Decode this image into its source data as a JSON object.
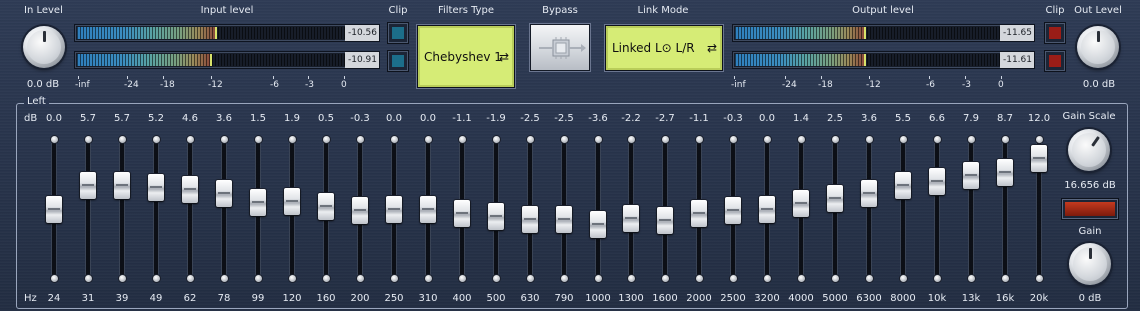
{
  "colors": {
    "lcd_bg": "#d6ec76",
    "clip_idle": "#1c6e8a",
    "clip_lit": "#9a1d17",
    "gain_scale_button": "#c43a1f"
  },
  "input": {
    "level_label": "In Level",
    "level_value": "0.0 dB",
    "meter_label": "Input level",
    "clip_label": "Clip",
    "channels": [
      {
        "value": "-10.56",
        "level": 0.52,
        "peak": 0.52
      },
      {
        "value": "-10.91",
        "level": 0.5,
        "peak": 0.5
      }
    ],
    "clip_leds": [
      "off",
      "off"
    ]
  },
  "meter_scale": [
    "-inf",
    "-24",
    "-18",
    "-12",
    "-6",
    "-3",
    "0"
  ],
  "filters": {
    "label": "Filters Type",
    "value": "Chebyshev 1",
    "icon": "swap-arrows-icon"
  },
  "bypass": {
    "label": "Bypass",
    "icon": "bypass-chip-icon"
  },
  "link": {
    "label": "Link Mode",
    "value": "Linked L⊙ L/R",
    "icon": "swap-arrows-icon"
  },
  "output": {
    "meter_label": "Output level",
    "clip_label": "Clip",
    "level_label": "Out Level",
    "level_value": "0.0 dB",
    "channels": [
      {
        "value": "-11.65",
        "level": 0.49,
        "peak": 0.49
      },
      {
        "value": "-11.61",
        "level": 0.49,
        "peak": 0.49
      }
    ],
    "clip_leds": [
      "on",
      "on"
    ]
  },
  "eq": {
    "group_label": "Left",
    "db_label": "dB",
    "hz_label": "Hz",
    "range_db": [
      -12,
      12
    ],
    "bands": [
      {
        "freq": "24",
        "gain": "0.0"
      },
      {
        "freq": "31",
        "gain": "5.7"
      },
      {
        "freq": "39",
        "gain": "5.7"
      },
      {
        "freq": "49",
        "gain": "5.2"
      },
      {
        "freq": "62",
        "gain": "4.6"
      },
      {
        "freq": "78",
        "gain": "3.6"
      },
      {
        "freq": "99",
        "gain": "1.5"
      },
      {
        "freq": "120",
        "gain": "1.9"
      },
      {
        "freq": "160",
        "gain": "0.5"
      },
      {
        "freq": "200",
        "gain": "-0.3"
      },
      {
        "freq": "250",
        "gain": "0.0"
      },
      {
        "freq": "310",
        "gain": "0.0"
      },
      {
        "freq": "400",
        "gain": "-1.1"
      },
      {
        "freq": "500",
        "gain": "-1.9"
      },
      {
        "freq": "630",
        "gain": "-2.5"
      },
      {
        "freq": "790",
        "gain": "-2.5"
      },
      {
        "freq": "1000",
        "gain": "-3.6"
      },
      {
        "freq": "1300",
        "gain": "-2.2"
      },
      {
        "freq": "1600",
        "gain": "-2.7"
      },
      {
        "freq": "2000",
        "gain": "-1.1"
      },
      {
        "freq": "2500",
        "gain": "-0.3"
      },
      {
        "freq": "3200",
        "gain": "0.0"
      },
      {
        "freq": "4000",
        "gain": "1.4"
      },
      {
        "freq": "5000",
        "gain": "2.5"
      },
      {
        "freq": "6300",
        "gain": "3.6"
      },
      {
        "freq": "8000",
        "gain": "5.5"
      },
      {
        "freq": "10k",
        "gain": "6.6"
      },
      {
        "freq": "13k",
        "gain": "7.9"
      },
      {
        "freq": "16k",
        "gain": "8.7"
      },
      {
        "freq": "20k",
        "gain": "12.0"
      }
    ],
    "gain_scale_label": "Gain Scale",
    "gain_scale_value": "16.656 dB",
    "gain_label": "Gain",
    "gain_value": "0 dB"
  }
}
